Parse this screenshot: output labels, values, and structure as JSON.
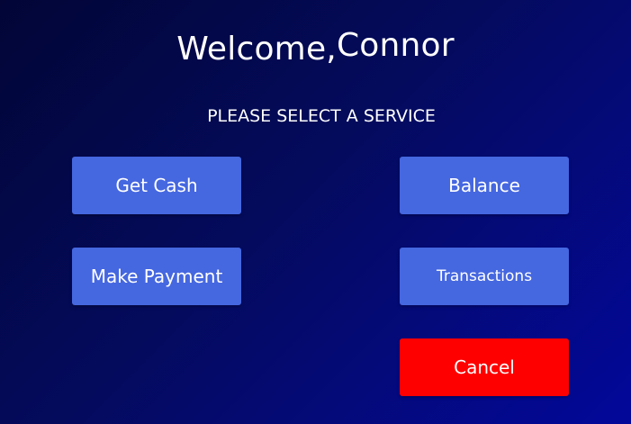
{
  "header": {
    "greeting": "Welcome,",
    "user_name": "Connor",
    "prompt": "PLEASE SELECT A SERVICE"
  },
  "services": {
    "get_cash": "Get Cash",
    "balance": "Balance",
    "make_payment": "Make Payment",
    "transactions": "Transactions",
    "cancel": "Cancel"
  },
  "colors": {
    "background_start": "#020536",
    "background_end": "#03089a",
    "button": "#4567e0",
    "cancel_button": "#fe0000",
    "text": "#ffffff"
  }
}
